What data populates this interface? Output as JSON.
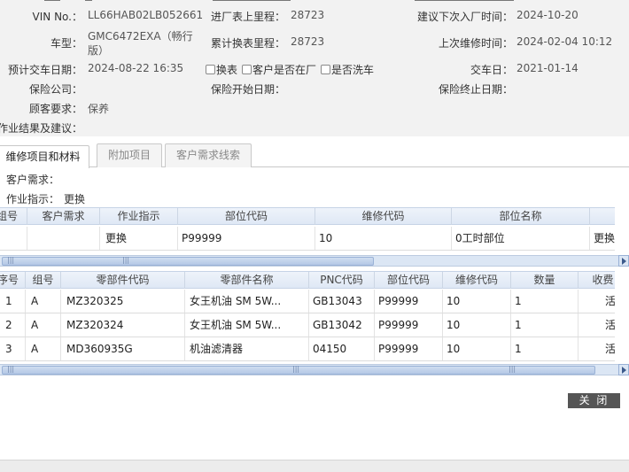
{
  "vehicle": {
    "vin_label": "VIN No.：",
    "vin_value": "LL66HAB02LB052661",
    "mileage_in_label": "进厂表上里程：",
    "mileage_in_value": "28723",
    "next_visit_label": "建议下次入厂时间：",
    "next_visit_value": "2024-10-20",
    "model_label": "车型：",
    "model_value_line1": "GMC6472EXA（畅行",
    "model_value_line2": "版）",
    "cumulative_mileage_label": "累计换表里程：",
    "cumulative_mileage_value": "28723",
    "last_repair_label": "上次维修时间：",
    "last_repair_value": "2024-02-04 10:12",
    "eta_label": "预计交车日期：",
    "eta_value": "2024-08-22 16:35",
    "cb_change_label": "换表",
    "cb_customer_label": "客户是否在厂",
    "cb_wash_label": "是否洗车",
    "delivery_label": "交车日：",
    "delivery_value": "2021-01-14",
    "insurer_label": "保险公司：",
    "insurer_value": "",
    "ins_start_label": "保险开始日期：",
    "ins_start_value": "",
    "ins_end_label": "保险终止日期：",
    "ins_end_value": "",
    "request_label": "顾客要求：",
    "request_value": "保养",
    "result_label": "作业结果及建议："
  },
  "tabs": [
    {
      "label": "维修项目和材料"
    },
    {
      "label": "附加项目"
    },
    {
      "label": "客户需求线索"
    }
  ],
  "info": {
    "customer_need_label": "客户需求：",
    "customer_need_value": "",
    "instruction_label": "作业指示：",
    "instruction_value": "更换"
  },
  "items_grid": {
    "headers": [
      "组号",
      "客户需求",
      "作业指示",
      "部位代码",
      "维修代码",
      "部位名称"
    ],
    "rows": [
      {
        "group": "",
        "need": "",
        "instruction": "更换",
        "position_code": "P99999",
        "repair_code": "10",
        "position_name": "0工时部位",
        "extra": "更换"
      }
    ]
  },
  "parts_grid": {
    "headers": [
      "序号",
      "组号",
      "零部件代码",
      "零部件名称",
      "PNC代码",
      "部位代码",
      "维修代码",
      "数量",
      "收费"
    ],
    "rows": [
      {
        "no": "1",
        "group": "A",
        "part_code": "MZ320325",
        "part_name": "女王机油 SM 5W...",
        "pnc": "GB13043",
        "position_code": "P99999",
        "repair_code": "10",
        "qty": "1",
        "fee": "活"
      },
      {
        "no": "2",
        "group": "A",
        "part_code": "MZ320324",
        "part_name": "女王机油 SM 5W...",
        "pnc": "GB13042",
        "position_code": "P99999",
        "repair_code": "10",
        "qty": "1",
        "fee": "活"
      },
      {
        "no": "3",
        "group": "A",
        "part_code": "MD360935G",
        "part_name": "机油滤清器",
        "pnc": "04150",
        "position_code": "P99999",
        "repair_code": "10",
        "qty": "1",
        "fee": "活"
      }
    ]
  },
  "actions": {
    "close_label": "关 闭"
  },
  "icons": {
    "scroll_right": "chevron-right-icon",
    "scroll_grip": "grip-icon"
  },
  "colors": {
    "header_bg": "#dfe8f5",
    "scroll_bg": "#dbe6f4",
    "close_btn": "#555555"
  }
}
